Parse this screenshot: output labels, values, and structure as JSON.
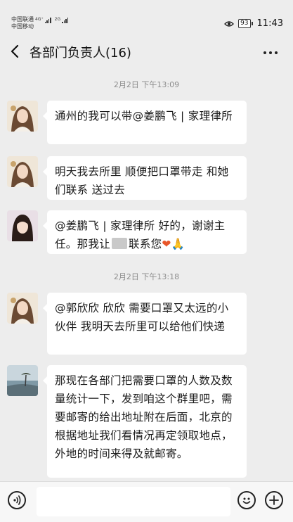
{
  "status_bar": {
    "carrier1": "中国联通",
    "carrier1_net": "4G⁺",
    "carrier2": "中国移动",
    "carrier2_net": "2G",
    "battery": "93",
    "time": "11:43"
  },
  "header": {
    "title": "各部门负责人(16)",
    "more_label": "···"
  },
  "messages": {
    "time1": "2月2日 下午13:09",
    "m1": "通州的我可以带@姜鹏飞 | 家理律所",
    "m2": "明天我去所里 顺便把口罩带走 和她们联系 送过去",
    "m3_before": "@姜鹏飞 | 家理律所   好的，谢谢主任。那我让",
    "m3_after": "联系您",
    "m3_emoji": "❤🙏",
    "time2": "2月2日 下午13:18",
    "m4": "@郭欣欣  欣欣 需要口罩又太远的小伙伴 我明天去所里可以给他们快递",
    "m5": "那现在各部门把需要口罩的人数及数量统计一下，发到咱这个群里吧，需要邮寄的给出地址附在后面，北京的根据地址我们看情况再定领取地点，外地的时间来得及就邮寄。"
  },
  "input_bar": {
    "placeholder": ""
  }
}
